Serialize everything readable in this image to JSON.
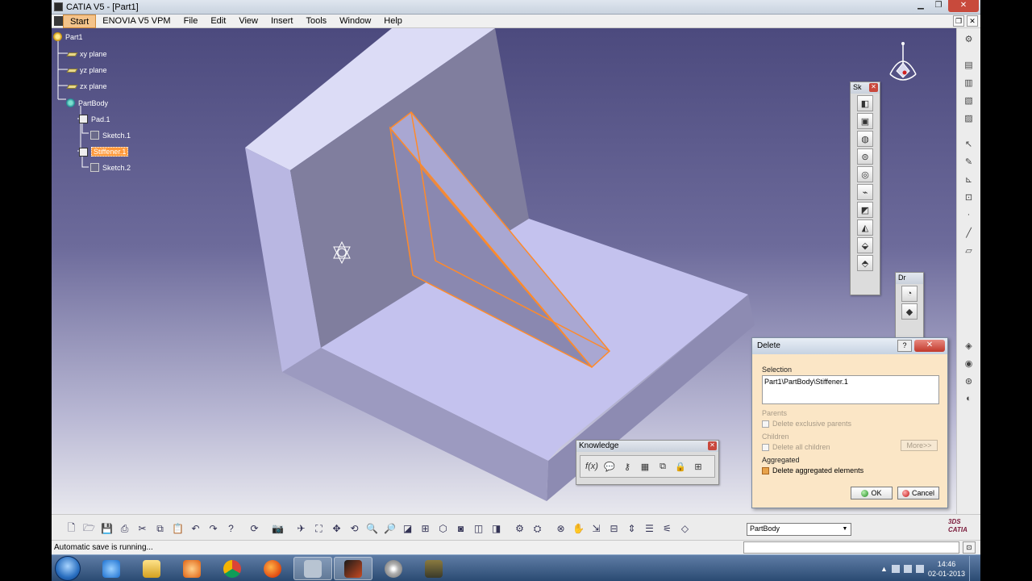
{
  "window": {
    "title": "CATIA V5 - [Part1]"
  },
  "menu": {
    "items": [
      "Start",
      "ENOVIA V5 VPM",
      "File",
      "Edit",
      "View",
      "Insert",
      "Tools",
      "Window",
      "Help"
    ]
  },
  "tree": {
    "root": "Part1",
    "xy_plane": "xy plane",
    "yz_plane": "yz plane",
    "zx_plane": "zx plane",
    "body": "PartBody",
    "pad": "Pad.1",
    "sketch1": "Sketch.1",
    "stiffener": "Stiffener.1",
    "sketch2": "Sketch.2"
  },
  "toolbars": {
    "sketch_based": {
      "title": "Sk",
      "icons": [
        "pad-icon",
        "pocket-icon",
        "shaft-icon",
        "groove-icon",
        "hole-icon",
        "rib-icon",
        "slot-icon",
        "stiffener-icon",
        "loft-icon",
        "remove-loft-icon"
      ]
    },
    "dress_up": {
      "title": "Dr"
    },
    "knowledge": {
      "title": "Knowledge",
      "icons": [
        "formula-icon",
        "comment-icon",
        "rule-icon",
        "table-icon",
        "structure-icon",
        "lock-icon",
        "parameter-icon"
      ]
    }
  },
  "delete_dialog": {
    "title": "Delete",
    "help": "?",
    "close": "✕",
    "selection_label": "Selection",
    "selection_value": "Part1\\PartBody\\Stiffener.1",
    "parents_label": "Parents",
    "delete_exclusive_parents": "Delete exclusive parents",
    "children_label": "Children",
    "delete_all_children": "Delete all children",
    "more_button": "More>>",
    "aggregated_label": "Aggregated",
    "delete_aggregated": "Delete aggregated elements",
    "ok_label": "OK",
    "cancel_label": "Cancel",
    "delete_aggregated_checked": true
  },
  "bottom_toolbar": {
    "current_body": "PartBody",
    "logo_text": "CATIA"
  },
  "status": {
    "message": "Automatic save is running..."
  },
  "taskbar": {
    "time": "14:46",
    "date": "02-01-2013"
  },
  "colors": {
    "viewport_top": "#4c4a7e",
    "model_face": "#c4c2ee",
    "selection_orange": "#ff8a2a",
    "dialog_bg": "#fbe6c6"
  }
}
